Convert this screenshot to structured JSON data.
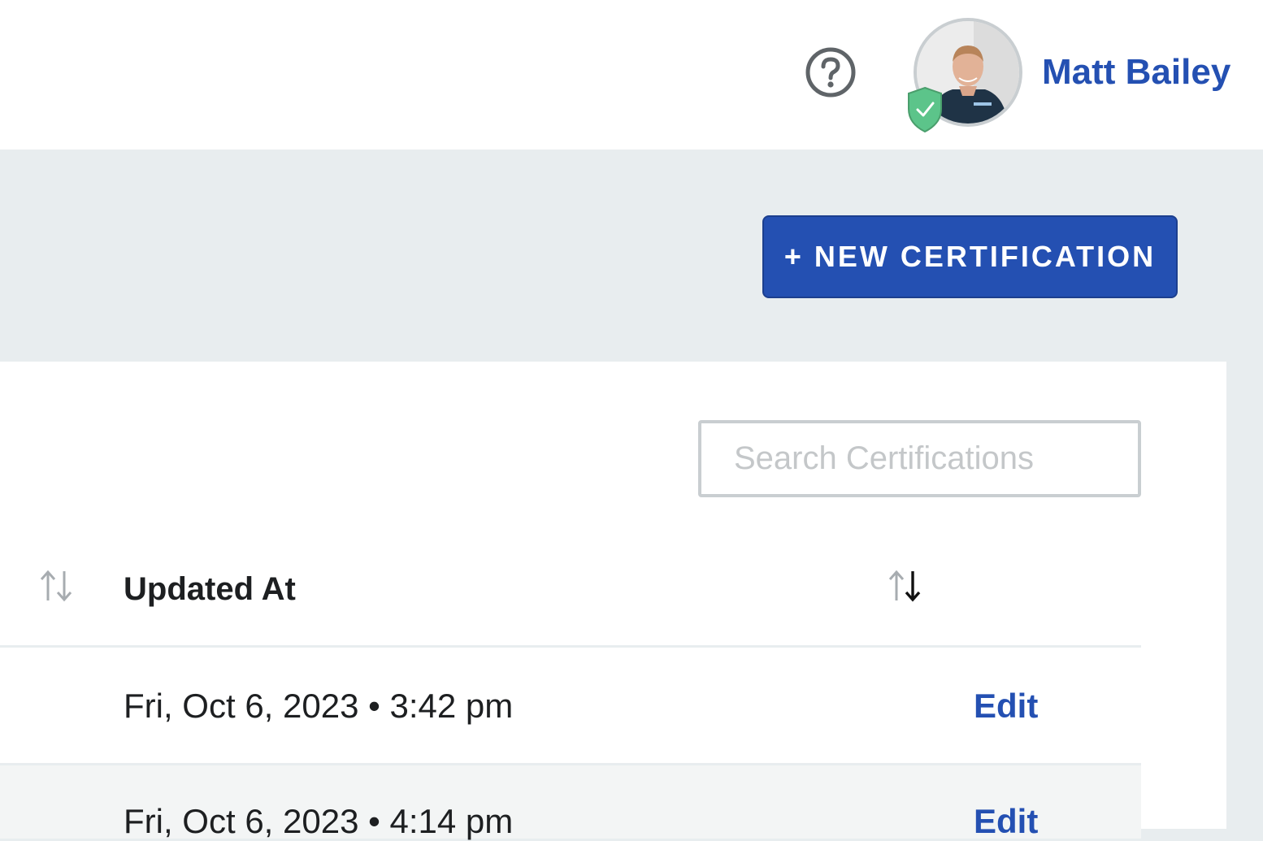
{
  "header": {
    "help_icon": "question-circle-icon",
    "user": {
      "name": "Matt Bailey",
      "avatar": "profile-photo",
      "verified_icon": "shield-check-icon"
    }
  },
  "toolbar": {
    "new_certification_label": "+ NEW CERTIFICATION"
  },
  "search": {
    "placeholder": "Search Certifications",
    "value": ""
  },
  "table": {
    "columns": [
      {
        "label": "",
        "sort_icon": "sort-arrows-icon",
        "sort_state": "none"
      },
      {
        "label": "Updated At",
        "sort_icon": "sort-arrows-icon",
        "sort_state": "descending"
      }
    ],
    "rows": [
      {
        "updated_at": "Fri, Oct 6, 2023 • 3:42 pm",
        "action": "Edit"
      },
      {
        "updated_at": "Fri, Oct 6, 2023 • 4:14 pm",
        "action": "Edit"
      }
    ]
  },
  "colors": {
    "primary": "#2450b2",
    "verified": "#5cc48a",
    "page_bg": "#e8edef"
  }
}
